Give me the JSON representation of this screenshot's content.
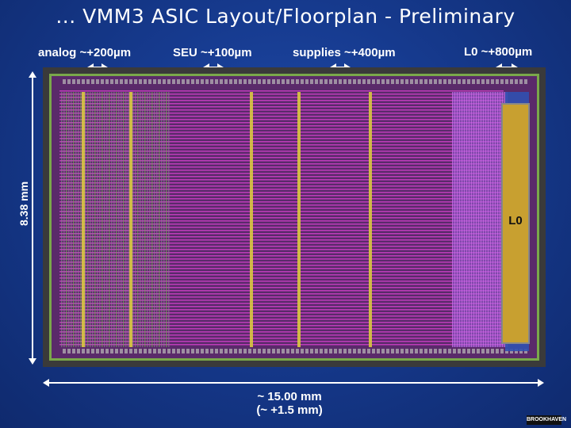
{
  "title": "... VMM3 ASIC Layout/Floorplan - Preliminary",
  "labels": {
    "analog": "analog ~+200µm",
    "seu": "SEU ~+100µm",
    "supplies": "supplies ~+400µm",
    "l0": "L0 ~+800µm",
    "l0_block": "L0"
  },
  "dimensions": {
    "height": "8.38 mm",
    "width_line1": "~ 15.00 mm",
    "width_line2": "(~ +1.5 mm)"
  },
  "logo_text": "BROOKHAVEN",
  "colors": {
    "background": "#163a8e",
    "chip_frame": "#3a3a3a",
    "core": "#5a2a6a",
    "magenta": "#d040c8",
    "red": "#d43030",
    "yellow": "#d9c840",
    "green": "#6fb84a",
    "l0_block": "#c8a030",
    "purple": "#a060e0"
  }
}
